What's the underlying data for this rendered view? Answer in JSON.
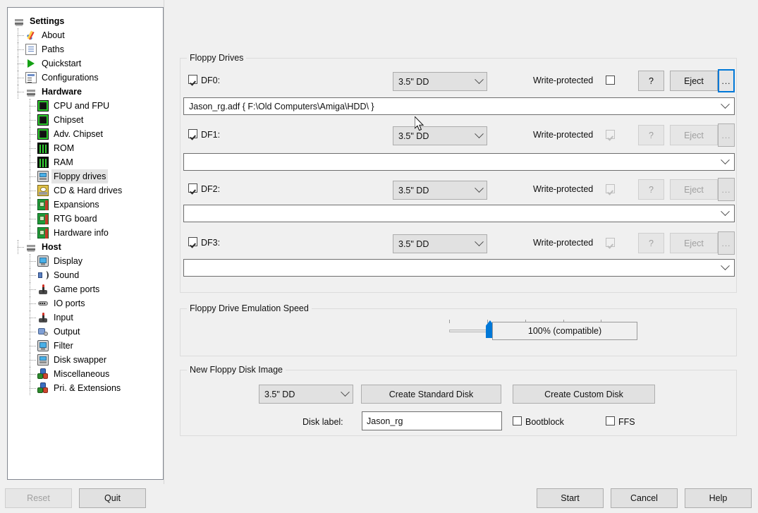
{
  "window": {
    "title": "Settings"
  },
  "sidebar": {
    "items": [
      {
        "label": "Settings",
        "icon": "disk-stack-icon",
        "depth": 0,
        "bold": true,
        "selected": false
      },
      {
        "label": "About",
        "icon": "checkmark-icon",
        "depth": 1,
        "bold": false,
        "selected": false
      },
      {
        "label": "Paths",
        "icon": "document-icon",
        "depth": 1,
        "bold": false,
        "selected": false
      },
      {
        "label": "Quickstart",
        "icon": "play-icon",
        "depth": 1,
        "bold": false,
        "selected": false
      },
      {
        "label": "Configurations",
        "icon": "config-list-icon",
        "depth": 1,
        "bold": false,
        "selected": false
      },
      {
        "label": "Hardware",
        "icon": "disk-stack-icon",
        "depth": 1,
        "bold": true,
        "selected": false
      },
      {
        "label": "CPU and FPU",
        "icon": "chip-icon",
        "depth": 2,
        "bold": false,
        "selected": false
      },
      {
        "label": "Chipset",
        "icon": "chip-icon",
        "depth": 2,
        "bold": false,
        "selected": false
      },
      {
        "label": "Adv. Chipset",
        "icon": "chip-icon",
        "depth": 2,
        "bold": false,
        "selected": false
      },
      {
        "label": "ROM",
        "icon": "memory-icon",
        "depth": 2,
        "bold": false,
        "selected": false
      },
      {
        "label": "RAM",
        "icon": "memory-icon",
        "depth": 2,
        "bold": false,
        "selected": false
      },
      {
        "label": "Floppy drives",
        "icon": "floppy-icon",
        "depth": 2,
        "bold": false,
        "selected": true
      },
      {
        "label": "CD & Hard drives",
        "icon": "harddisk-icon",
        "depth": 2,
        "bold": false,
        "selected": false
      },
      {
        "label": "Expansions",
        "icon": "board-icon",
        "depth": 2,
        "bold": false,
        "selected": false
      },
      {
        "label": "RTG board",
        "icon": "board-icon",
        "depth": 2,
        "bold": false,
        "selected": false
      },
      {
        "label": "Hardware info",
        "icon": "board-icon",
        "depth": 2,
        "bold": false,
        "selected": false
      },
      {
        "label": "Host",
        "icon": "disk-stack-icon",
        "depth": 1,
        "bold": true,
        "selected": false
      },
      {
        "label": "Display",
        "icon": "monitor-icon",
        "depth": 2,
        "bold": false,
        "selected": false
      },
      {
        "label": "Sound",
        "icon": "speaker-icon",
        "depth": 2,
        "bold": false,
        "selected": false
      },
      {
        "label": "Game ports",
        "icon": "joystick-icon",
        "depth": 2,
        "bold": false,
        "selected": false
      },
      {
        "label": "IO ports",
        "icon": "io-port-icon",
        "depth": 2,
        "bold": false,
        "selected": false
      },
      {
        "label": "Input",
        "icon": "joystick-icon",
        "depth": 2,
        "bold": false,
        "selected": false
      },
      {
        "label": "Output",
        "icon": "output-icon",
        "depth": 2,
        "bold": false,
        "selected": false
      },
      {
        "label": "Filter",
        "icon": "monitor-icon",
        "depth": 2,
        "bold": false,
        "selected": false
      },
      {
        "label": "Disk swapper",
        "icon": "floppy-icon",
        "depth": 2,
        "bold": false,
        "selected": false
      },
      {
        "label": "Miscellaneous",
        "icon": "cubes-icon",
        "depth": 2,
        "bold": false,
        "selected": false
      },
      {
        "label": "Pri. & Extensions",
        "icon": "cubes-icon",
        "depth": 2,
        "bold": false,
        "selected": false
      }
    ]
  },
  "floppy_drives": {
    "legend": "Floppy Drives",
    "write_protected_label": "Write-protected",
    "help_label": "?",
    "eject_label": "Eject",
    "browse_label": "...",
    "rows": [
      {
        "name": "DF0:",
        "enabled": true,
        "type": "3.5\" DD",
        "write_protected": false,
        "write_protected_disabled": false,
        "controls_disabled": false,
        "browse_focused": true,
        "path": "Jason_rg.adf { F:\\Old Computers\\Amiga\\HDD\\ }"
      },
      {
        "name": "DF1:",
        "enabled": true,
        "type": "3.5\" DD",
        "write_protected": true,
        "write_protected_disabled": true,
        "controls_disabled": true,
        "browse_focused": false,
        "path": ""
      },
      {
        "name": "DF2:",
        "enabled": true,
        "type": "3.5\" DD",
        "write_protected": true,
        "write_protected_disabled": true,
        "controls_disabled": true,
        "browse_focused": false,
        "path": ""
      },
      {
        "name": "DF3:",
        "enabled": true,
        "type": "3.5\" DD",
        "write_protected": true,
        "write_protected_disabled": true,
        "controls_disabled": true,
        "browse_focused": false,
        "path": ""
      }
    ]
  },
  "emulation_speed": {
    "legend": "Floppy Drive Emulation Speed",
    "value_label": "100% (compatible)",
    "slider": {
      "min": 0,
      "max": 4,
      "value": 1,
      "ticks": 5
    }
  },
  "new_disk_image": {
    "legend": "New Floppy Disk Image",
    "type": "3.5\" DD",
    "create_standard_label": "Create Standard Disk",
    "create_custom_label": "Create Custom Disk",
    "disk_label_caption": "Disk label:",
    "disk_label_value": "Jason_rg",
    "bootblock_label": "Bootblock",
    "bootblock_checked": false,
    "ffs_label": "FFS",
    "ffs_checked": false
  },
  "footer": {
    "reset_label": "Reset",
    "reset_disabled": true,
    "quit_label": "Quit",
    "start_label": "Start",
    "cancel_label": "Cancel",
    "help_label": "Help"
  },
  "colors": {
    "accent": "#0078d7",
    "window_bg": "#f0f0f0",
    "field_bg": "#ffffff",
    "button_bg": "#e1e1e1",
    "selection_bg": "#e4e4e4"
  }
}
